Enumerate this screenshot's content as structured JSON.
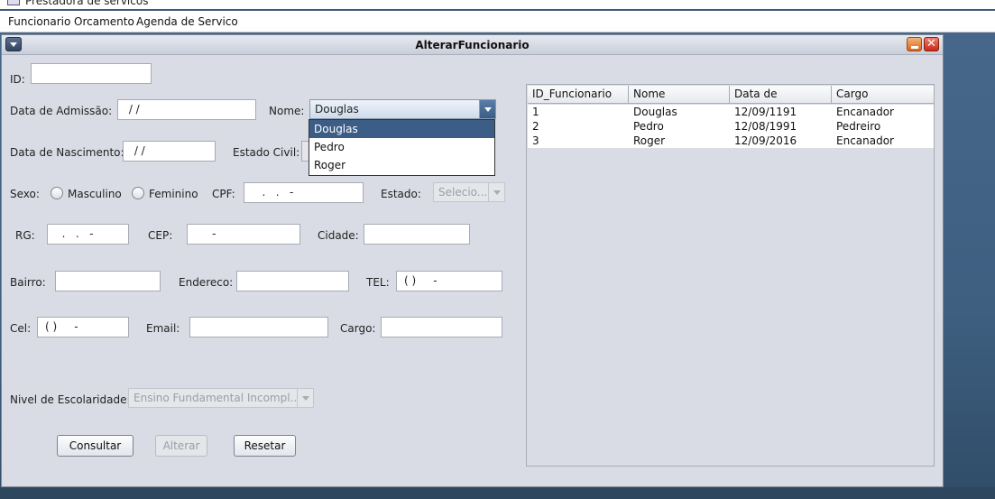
{
  "app": {
    "title": "Prestadora de servicos"
  },
  "menu": [
    {
      "label": "Funcionario"
    },
    {
      "label": "Orcamento"
    },
    {
      "label": "Agenda de Servico"
    }
  ],
  "frame": {
    "title": "AlterarFuncionario",
    "close_glyph": "✕"
  },
  "form": {
    "id_label": "ID:",
    "id_value": "",
    "admissao_label": "Data de Admissão:",
    "admissao_value": " / /",
    "nome_label": "Nome:",
    "nome_selected": "Douglas",
    "nome_options": [
      "Douglas",
      "Pedro",
      "Roger"
    ],
    "nascimento_label": "Data de Nascimento:",
    "nascimento_value": " / /",
    "estado_civil_label": "Estado Civil:",
    "sexo_label": "Sexo:",
    "masculino_label": "Masculino",
    "feminino_label": "Feminino",
    "cpf_label": "CPF:",
    "cpf_value": "   .   .   -",
    "estado_label": "Estado:",
    "estado_selected": "Selecio...",
    "rg_label": "RG:",
    "rg_value": "  .   .   -",
    "cep_label": "CEP:",
    "cep_value": "     -",
    "cidade_label": "Cidade:",
    "cidade_value": "",
    "bairro_label": "Bairro:",
    "bairro_value": "",
    "endereco_label": "Endereco:",
    "endereco_value": "",
    "tel_label": "TEL:",
    "tel_value": "( )     -",
    "cel_label": "Cel:",
    "cel_value": "( )     -",
    "email_label": "Email:",
    "email_value": "",
    "cargo_label": "Cargo:",
    "cargo_value": "",
    "escolaridade_label": "Nivel de Escolaridade:",
    "escolaridade_selected": "Ensino Fundamental Incompl..."
  },
  "buttons": {
    "consultar": "Consultar",
    "alterar": "Alterar",
    "resetar": "Resetar"
  },
  "table": {
    "columns": [
      "ID_Funcionario",
      "Nome",
      "Data de Admissão",
      "Cargo"
    ],
    "rows": [
      [
        "1",
        "Douglas",
        "12/09/1191",
        "Encanador"
      ],
      [
        "2",
        "Pedro",
        "12/08/1991",
        "Pedreiro"
      ],
      [
        "3",
        "Roger",
        "12/09/2016",
        "Encanador"
      ]
    ]
  }
}
